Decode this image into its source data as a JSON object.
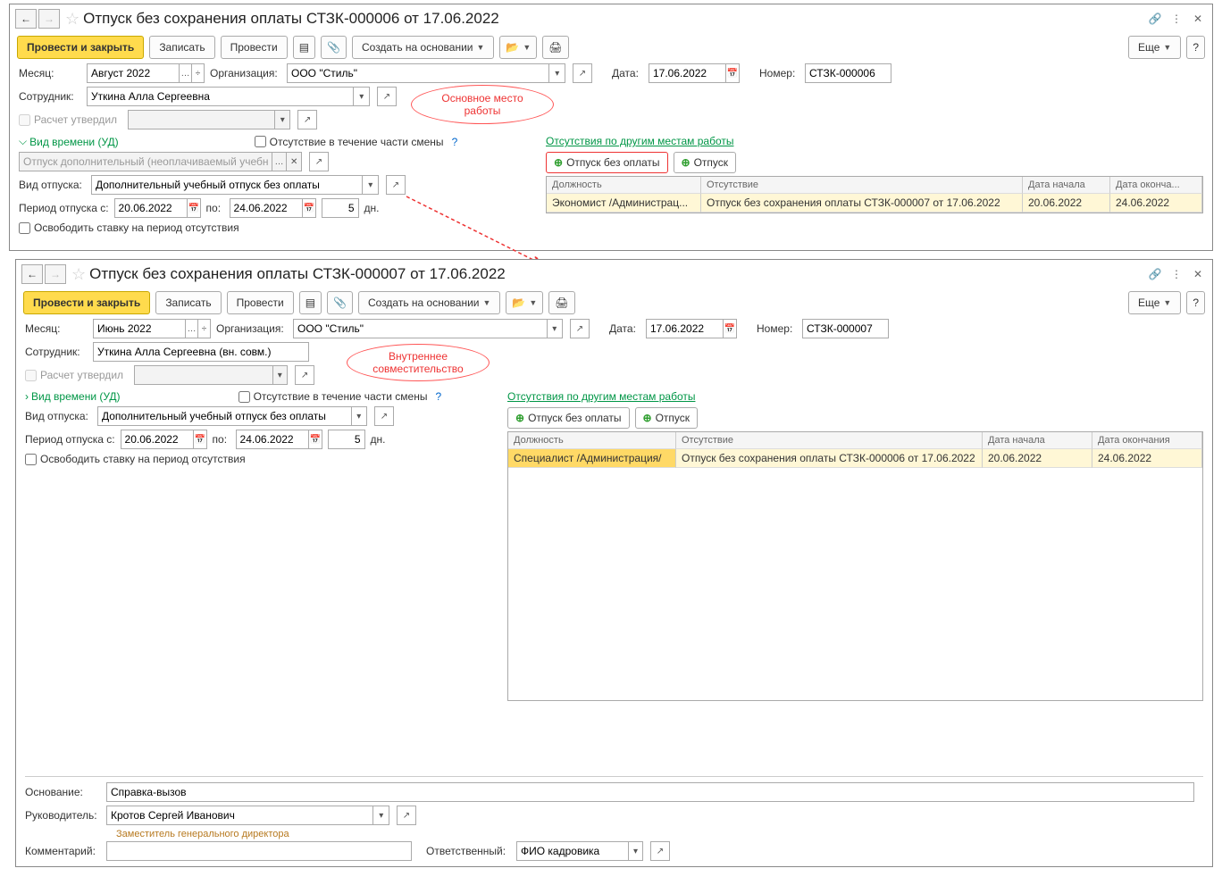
{
  "win1": {
    "title": "Отпуск без сохранения оплаты СТЗК-000006 от 17.06.2022",
    "toolbar": {
      "submit": "Провести и закрыть",
      "save": "Записать",
      "post": "Провести",
      "createBase": "Создать на основании",
      "more": "Еще"
    },
    "month": {
      "label": "Месяц:",
      "value": "Август 2022"
    },
    "org": {
      "label": "Организация:",
      "value": "ООО \"Стиль\""
    },
    "date": {
      "label": "Дата:",
      "value": "17.06.2022"
    },
    "number": {
      "label": "Номер:",
      "value": "СТЗК-000006"
    },
    "employee": {
      "label": "Сотрудник:",
      "value": "Уткина Алла Сергеевна"
    },
    "approved": "Расчет утвердил",
    "timeKind": "Вид времени (УД)",
    "timeKindValue": "Отпуск дополнительный (неоплачиваемый учебный)",
    "partShift": "Отсутствие в течение части смены",
    "otherPlacesLink": "Отсутствия по другим местам работы",
    "addUnpaid": "Отпуск без оплаты",
    "addLeave": "Отпуск",
    "leaveType": {
      "label": "Вид отпуска:",
      "value": "Дополнительный учебный отпуск без оплаты"
    },
    "period": {
      "from": "Период отпуска с:",
      "fromVal": "20.06.2022",
      "to": "по:",
      "toVal": "24.06.2022",
      "days": "5",
      "daysLbl": "дн."
    },
    "releaseRate": "Освободить ставку на период отсутствия",
    "callout": "Основное место работы",
    "table": {
      "hPos": "Должность",
      "hAbs": "Отсутствие",
      "hFrom": "Дата начала",
      "hTo": "Дата оконча...",
      "row": {
        "pos": "Экономист /Администрац...",
        "abs": "Отпуск без сохранения оплаты СТЗК-000007 от 17.06.2022",
        "from": "20.06.2022",
        "to": "24.06.2022"
      }
    }
  },
  "win2": {
    "title": "Отпуск без сохранения оплаты СТЗК-000007 от 17.06.2022",
    "month": {
      "label": "Месяц:",
      "value": "Июнь 2022"
    },
    "org": {
      "label": "Организация:",
      "value": "ООО \"Стиль\""
    },
    "date": {
      "label": "Дата:",
      "value": "17.06.2022"
    },
    "number": {
      "label": "Номер:",
      "value": "СТЗК-000007"
    },
    "employee": {
      "label": "Сотрудник:",
      "value": "Уткина Алла Сергеевна (вн. совм.)"
    },
    "callout": "Внутреннее совместительство",
    "period": {
      "fromVal": "20.06.2022",
      "toVal": "24.06.2022",
      "days": "5"
    },
    "table": {
      "hPos": "Должность",
      "hAbs": "Отсутствие",
      "hFrom": "Дата начала",
      "hTo": "Дата окончания",
      "row": {
        "pos": "Специалист /Администрация/",
        "abs": "Отпуск без сохранения оплаты СТЗК-000006 от 17.06.2022",
        "from": "20.06.2022",
        "to": "24.06.2022"
      }
    },
    "basis": {
      "label": "Основание:",
      "value": "Справка-вызов"
    },
    "head": {
      "label": "Руководитель:",
      "value": "Кротов Сергей Иванович",
      "hint": "Заместитель генерального директора"
    },
    "comment": {
      "label": "Комментарий:"
    },
    "resp": {
      "label": "Ответственный:",
      "value": "ФИО кадровика"
    }
  }
}
